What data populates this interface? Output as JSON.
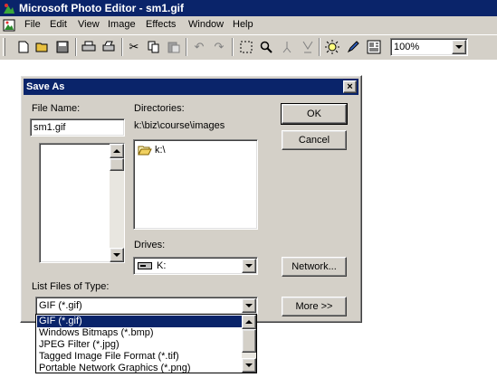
{
  "app": {
    "title": "Microsoft Photo Editor - sm1.gif"
  },
  "menu": [
    "File",
    "Edit",
    "View",
    "Image",
    "Effects",
    "Window",
    "Help"
  ],
  "toolbar": {
    "zoom_value": "100%"
  },
  "dialog": {
    "title": "Save As",
    "close_glyph": "×",
    "file_name_label": "File Name:",
    "file_name_value": "sm1.gif",
    "directories_label": "Directories:",
    "current_path": "k:\\biz\\course\\images",
    "directory_item": "k:\\",
    "drives_label": "Drives:",
    "drive_value": "K:",
    "list_types_label": "List Files of Type:",
    "type_value": "GIF (*.gif)",
    "ok_label": "OK",
    "cancel_label": "Cancel",
    "network_label": "Network...",
    "more_label": "More >>"
  },
  "file_type_options": [
    "GIF (*.gif)",
    "Windows Bitmaps (*.bmp)",
    "JPEG Filter (*.jpg)",
    "Tagged Image File Format (*.tif)",
    "Portable Network Graphics (*.png)"
  ],
  "selected_type_index": 0
}
